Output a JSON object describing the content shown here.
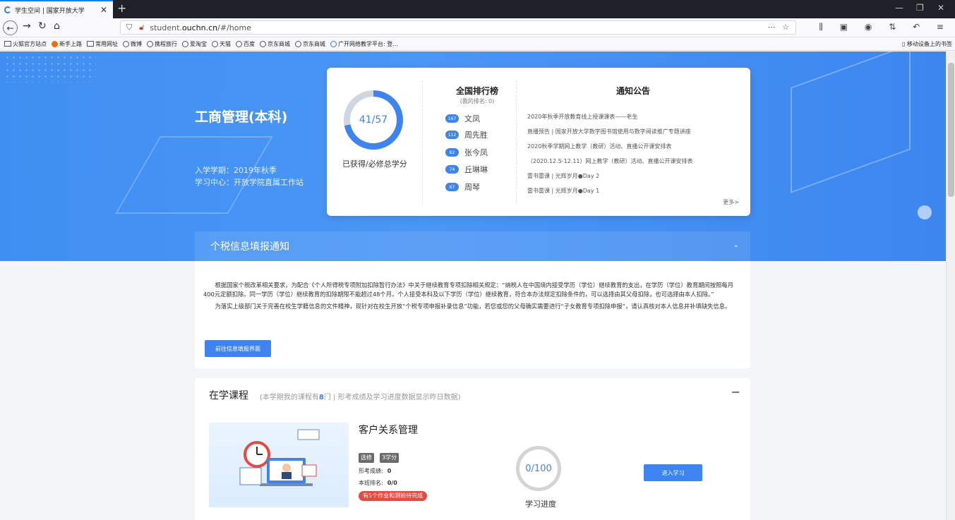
{
  "browser": {
    "tab_title": "学生空间 | 国家开放大学",
    "url_prefix": "student.",
    "url_host": "ouchn.cn",
    "url_path": "/#/home",
    "bookmarks": [
      "火狐官方站点",
      "新手上路",
      "常用网址",
      "微博",
      "携程旅行",
      "爱淘宝",
      "天猫",
      "百度",
      "京东商城",
      "京东商城",
      "广开网络教学平台: 登..."
    ],
    "mobile_bookmarks": "移动设备上的书签"
  },
  "hero": {
    "major": "工商管理(本科)",
    "enrollment": "入学学期：2019年秋季",
    "study_center": "学习中心：开放学院直属工作站"
  },
  "credits": {
    "earned": 41,
    "required": 57,
    "display": "41/57",
    "label": "已获得/必修总学分"
  },
  "ranking": {
    "title": "全国排行榜",
    "my_rank": "(我的排名: 0)",
    "entries": [
      {
        "score": "167",
        "name": "文凤"
      },
      {
        "score": "112",
        "name": "周先胜"
      },
      {
        "score": "82",
        "name": "张今凤"
      },
      {
        "score": "74",
        "name": "丘琳琳"
      },
      {
        "score": "67",
        "name": "周琴"
      }
    ]
  },
  "notices": {
    "title": "通知公告",
    "items": [
      "2020年秋季开放教育线上授课课表——老生",
      "直播预告 | 国家开放大学数字图书馆使用与数字阅读推广专题讲座",
      "2020秋季学期网上教学（教研）活动、直播公开课安排表",
      "（2020.12.5-12.11）网上教学（教研）活动、直播公开课安排表",
      "雷书雷课 | 光辉岁月●Day 2",
      "雷书雷课 | 光辉岁月●Day 1"
    ],
    "more": "更多>"
  },
  "tax_notice": {
    "title": "个税信息填报通知",
    "para1": "根据国家个税改革相关要求，为配合《个人所得税专项附加扣除暂行办法》中关于继续教育专项扣除相关规定：“纳税人在中国境内接受学历（学位）继续教育的支出，在学历（学位）教育期间按照每月400元定额扣除。同一学历（学位）继续教育的扣除期限不能超过48个月。个人接受本科及以下学历（学位）继续教育，符合本办法规定扣除条件的，可以选择由其父母扣除，也可选择由本人扣除。”",
    "para2": "为落实上级部门关于完善在校生学籍信息的文件精神，现针对在校生开放“个税专项申报补录信息”功能，若您或您的父母确实需要进行“子女教育专项扣除申报”，请认真核对本人信息并补填缺失信息。",
    "button": "前往信息填报界面"
  },
  "courses": {
    "title": "在学课程",
    "subtitle_pre": "(本学期我的课程有",
    "count": "8",
    "subtitle_post": "门 | 形考成绩及学习进度数据显示昨日数据)",
    "collapse": "−",
    "items": [
      {
        "name": "客户关系管理",
        "tag_type": "选修",
        "tag_credit": "3学分",
        "score_label": "形考成绩:",
        "score": "0",
        "rank_label": "本班排名:",
        "rank": "0/0",
        "warning": "有5个作业和测验待完成",
        "progress": "0/100",
        "progress_label": "学习进度",
        "enter": "进入学习"
      }
    ]
  }
}
